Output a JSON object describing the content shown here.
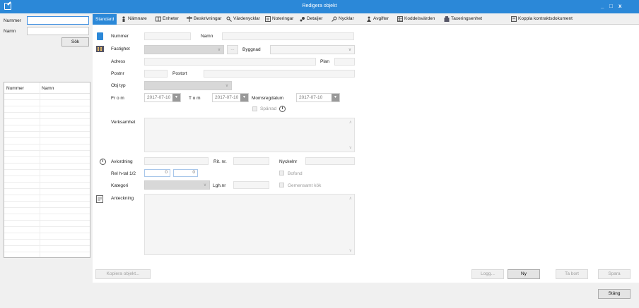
{
  "window": {
    "title": "Redigera objekt",
    "minimize": "_",
    "maximize": "□",
    "close": "x"
  },
  "search": {
    "nummer_label": "Nummer",
    "nummer_value": "",
    "namn_label": "Namn",
    "namn_value": "",
    "sok_label": "Sök"
  },
  "grid": {
    "columns": [
      "Nummer",
      "Namn"
    ]
  },
  "tabs": [
    {
      "label": "Standard",
      "icon": "list-icon"
    },
    {
      "label": "Nämnare",
      "icon": "person-icon"
    },
    {
      "label": "Enheter",
      "icon": "units-icon"
    },
    {
      "label": "Beskrivningar",
      "icon": "signpost-icon"
    },
    {
      "label": "Värdenycklar",
      "icon": "key-icon"
    },
    {
      "label": "Noteringar",
      "icon": "notes-icon"
    },
    {
      "label": "Detaljer",
      "icon": "details-icon"
    },
    {
      "label": "Nycklar",
      "icon": "key-icon"
    },
    {
      "label": "Avgifter",
      "icon": "fee-icon"
    },
    {
      "label": "Koddelsvärden",
      "icon": "table-icon"
    },
    {
      "label": "Taxeringsenhet",
      "icon": "building-icon"
    },
    {
      "label": "Koppla kontraktsdokument",
      "icon": "document-icon"
    }
  ],
  "form": {
    "nummer_label": "Nummer",
    "nummer_value": "",
    "namn_label": "Namn",
    "namn_value": "",
    "fastighet_label": "Fastighet",
    "fastighet_value": "",
    "browse_label": "...",
    "byggnad_label": "Byggnad",
    "byggnad_value": "",
    "adress_label": "Adress",
    "adress_value": "",
    "plan_label": "Plan",
    "plan_value": "",
    "postnr_label": "Postnr",
    "postnr_value": "",
    "postort_label": "Postort",
    "postort_value": "",
    "objtyp_label": "Obj typ",
    "objtyp_value": "",
    "from_label": "Fr o m",
    "from_value": "2017-07-10",
    "tom_label": "T o m",
    "tom_value": "2017-07-10",
    "momsregdatum_label": "Momsregdatum",
    "momsregdatum_value": "2017-07-10",
    "sparrad_label": "Spärrad",
    "verksamhet_label": "Verksamhet",
    "verksamhet_value": "",
    "avirordning_label": "Aviordning",
    "avirordning_value": "",
    "ritnr_label": "Rit. nr.",
    "ritnr_value": "",
    "nyckelnr_label": "Nyckelnr",
    "nyckelnr_value": "",
    "relhtal_label": "Rel h-tal 1/2",
    "relhtal1_value": "0",
    "relhtal2_value": "0",
    "bofond_label": "Bofond",
    "kategori_label": "Kategori",
    "kategori_value": "",
    "lghnr_label": "Lgh.nr",
    "lghnr_value": "",
    "gemensamt_kok_label": "Gemensamt kök",
    "anteckning_label": "Anteckning",
    "anteckning_value": ""
  },
  "buttons": {
    "kopiera_objekt": "Kopiera objekt...",
    "logg": "Logg...",
    "ny": "Ny",
    "ta_bort": "Ta bort",
    "spara": "Spara",
    "stang": "Stäng"
  }
}
